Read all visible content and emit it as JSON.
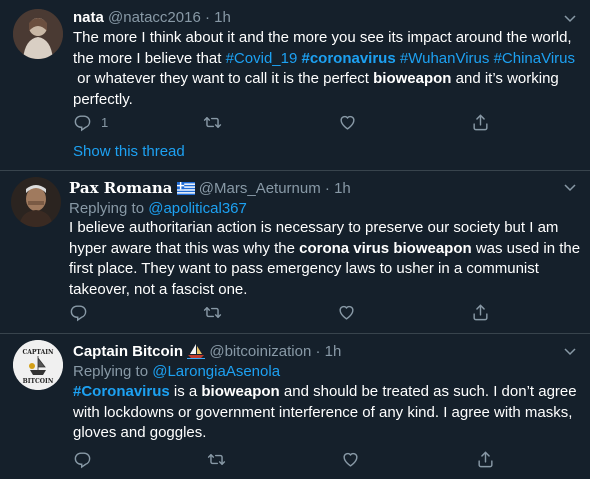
{
  "tweets": [
    {
      "name": "nata",
      "handle": "@natacc2016",
      "dot": "·",
      "time": "1h",
      "body_lines": [
        [
          {
            "t": "The more I think about it and the more you see its impact around the world,",
            "s": "n"
          }
        ],
        [
          {
            "t": "the more I believe that ",
            "s": "n"
          },
          {
            "t": "#Covid_19",
            "s": "h"
          },
          {
            "t": " ",
            "s": "n"
          },
          {
            "t": "#coronavirus",
            "s": "hb"
          },
          {
            "t": " ",
            "s": "n"
          },
          {
            "t": "#WuhanVirus",
            "s": "h"
          },
          {
            "t": " ",
            "s": "n"
          },
          {
            "t": "#ChinaVirus",
            "s": "h"
          }
        ],
        [
          {
            "t": " or whatever they want to call it is the perfect ",
            "s": "n"
          },
          {
            "t": "bioweapon",
            "s": "b"
          },
          {
            "t": " and it’s working",
            "s": "n"
          }
        ],
        [
          {
            "t": "perfectly.",
            "s": "n"
          }
        ]
      ],
      "reply_count": "1",
      "show_thread": "Show this thread"
    },
    {
      "name": "Pax Romana",
      "flag": "greek-flag-icon",
      "handle": "@Mars_Aeturnum",
      "dot": "·",
      "time": "1h",
      "replying_prefix": "Replying to",
      "replying_to": "@apolitical367",
      "body_lines": [
        [
          {
            "t": "I believe authoritarian action is necessary to preserve our society but I am",
            "s": "n"
          }
        ],
        [
          {
            "t": "hyper aware that this was why the ",
            "s": "n"
          },
          {
            "t": "corona virus bioweapon",
            "s": "b"
          },
          {
            "t": " was used in the",
            "s": "n"
          }
        ],
        [
          {
            "t": "first place. They want to pass emergency laws to usher in a communist",
            "s": "n"
          }
        ],
        [
          {
            "t": "takeover, not a fascist one.",
            "s": "n"
          }
        ]
      ]
    },
    {
      "name": "Captain Bitcoin",
      "badge": "sailboat-icon",
      "handle": "@bitcoinization",
      "dot": "·",
      "time": "1h",
      "replying_prefix": "Replying to",
      "replying_to": "@LarongiaAsenola",
      "avatar_text_top": "CAPTAIN",
      "avatar_text_bottom": "BITCOIN",
      "body_lines": [
        [
          {
            "t": "#Coronavirus",
            "s": "hb"
          },
          {
            "t": " is a ",
            "s": "n"
          },
          {
            "t": "bioweapon",
            "s": "b"
          },
          {
            "t": " and should be treated as such. I don’t agree",
            "s": "n"
          }
        ],
        [
          {
            "t": "with lockdowns or government interference of any kind. I agree with masks,",
            "s": "n"
          }
        ],
        [
          {
            "t": "gloves and goggles.",
            "s": "n"
          }
        ]
      ]
    }
  ],
  "colors": {
    "background": "#15202b",
    "link": "#1da1f2",
    "muted": "#8899a6",
    "divider": "#38444d"
  }
}
